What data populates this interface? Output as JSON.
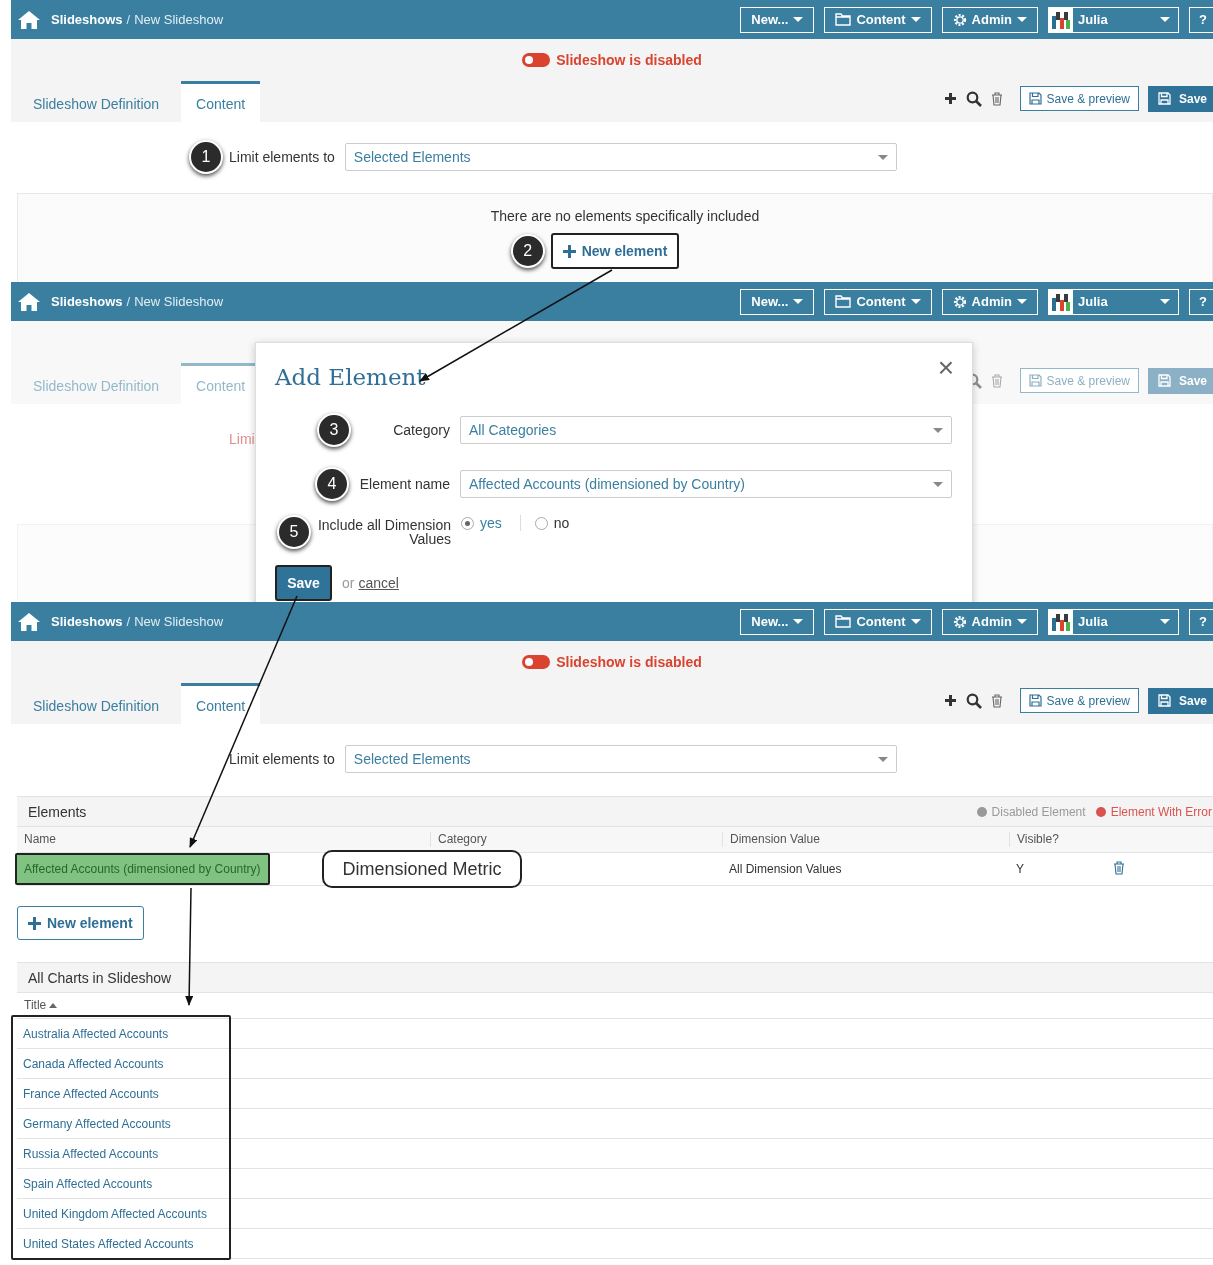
{
  "screens": [
    {
      "kind": "empty",
      "header": {
        "crumb_root": "Slideshows",
        "separator": "/",
        "crumb_current": "New Slideshow",
        "new_menu": "New...",
        "content_menu": "Content",
        "admin_menu": "Admin",
        "user": "Julia",
        "help": "?"
      },
      "status": {
        "text": "Slideshow is disabled",
        "enabled": false
      },
      "tabs": [
        {
          "label": "Slideshow Definition",
          "selected": false
        },
        {
          "label": "Content",
          "selected": true
        }
      ],
      "actions": {
        "preview": "Save & preview",
        "save": "Save"
      },
      "limit": {
        "label": "Limit elements to",
        "value": "Selected Elements",
        "step": "1"
      },
      "message": "There are no elements specifically included",
      "new_button": {
        "label": "New element",
        "step": "2"
      }
    },
    {
      "kind": "dialog",
      "header": {
        "crumb_root": "Slideshows",
        "separator": "/",
        "crumb_current": "New Slideshow",
        "new_menu": "New...",
        "content_menu": "Content",
        "admin_menu": "Admin",
        "user": "Julia",
        "help": "?"
      },
      "tabs": [
        {
          "label": "Slideshow Definition",
          "selected": false
        },
        {
          "label": "Content",
          "selected": true
        }
      ],
      "actions": {
        "preview": "Save & preview",
        "save": "Save"
      },
      "limit": {
        "label": "Limi"
      },
      "dialog": {
        "title": "Add Element",
        "close": "×",
        "fields": [
          {
            "kind": "select",
            "label": "Category",
            "value": "All Categories",
            "step": "3"
          },
          {
            "kind": "select",
            "label": "Element name",
            "value": "Affected Accounts (dimensioned by Country)",
            "step": "4"
          },
          {
            "kind": "radio",
            "label": "Include all Dimension Values",
            "step": "5",
            "options": [
              {
                "label": "yes",
                "selected": true
              },
              {
                "label": "no",
                "selected": false
              }
            ]
          }
        ],
        "save": "Save",
        "or": "or",
        "cancel": "cancel"
      }
    },
    {
      "kind": "list",
      "header": {
        "crumb_root": "Slideshows",
        "separator": "/",
        "crumb_current": "New Slideshow",
        "new_menu": "New...",
        "content_menu": "Content",
        "admin_menu": "Admin",
        "user": "Julia",
        "help": "?"
      },
      "status": {
        "text": "Slideshow is disabled",
        "enabled": false
      },
      "tabs": [
        {
          "label": "Slideshow Definition",
          "selected": false
        },
        {
          "label": "Content",
          "selected": true
        }
      ],
      "actions": {
        "preview": "Save & preview",
        "save": "Save"
      },
      "limit": {
        "label": "Limit elements to",
        "value": "Selected Elements"
      },
      "elements": {
        "title": "Elements",
        "legend": [
          {
            "label": "Disabled Element",
            "color": "#999999"
          },
          {
            "label": "Element With Error",
            "color": "#d9534f"
          }
        ],
        "columns": [
          "Name",
          "Category",
          "Dimension Value",
          "Visible?"
        ],
        "rows": [
          {
            "name": "Affected Accounts (dimensioned by Country)",
            "highlighted": true,
            "dimension_value": "All Dimension Values",
            "visible": "Y"
          }
        ],
        "callout": "Dimensioned Metric"
      },
      "new_button": {
        "label": "New element"
      },
      "charts": {
        "title": "All Charts in Slideshow",
        "column": "Title",
        "items": [
          "Australia Affected Accounts",
          "Canada Affected Accounts",
          "France Affected Accounts",
          "Germany Affected Accounts",
          "Russia Affected Accounts",
          "Spain Affected Accounts",
          "United Kingdom Affected Accounts",
          "United States Affected Accounts"
        ]
      }
    }
  ]
}
